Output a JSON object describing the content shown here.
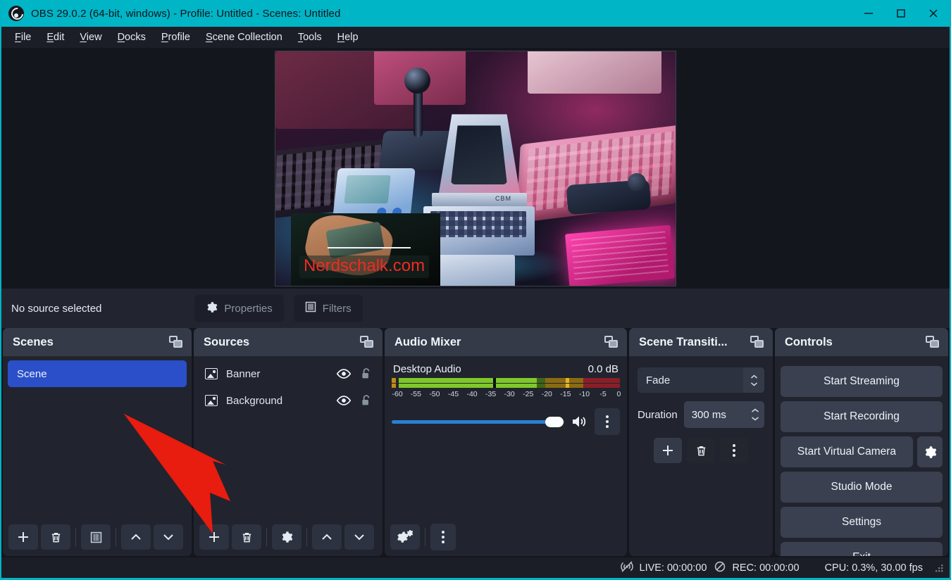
{
  "window": {
    "title": "OBS 29.0.2 (64-bit, windows) - Profile: Untitled - Scenes: Untitled",
    "logo": "obs-logo-icon",
    "accent_color": "#00b5c6",
    "controls": {
      "minimize": "minimize-icon",
      "maximize": "maximize-icon",
      "close": "close-icon"
    }
  },
  "menubar": {
    "items": [
      {
        "label": "File",
        "mnemonic": "F"
      },
      {
        "label": "Edit",
        "mnemonic": "E"
      },
      {
        "label": "View",
        "mnemonic": "V"
      },
      {
        "label": "Docks",
        "mnemonic": "D"
      },
      {
        "label": "Profile",
        "mnemonic": "P"
      },
      {
        "label": "Scene Collection",
        "mnemonic": "S"
      },
      {
        "label": "Tools",
        "mnemonic": "T"
      },
      {
        "label": "Help",
        "mnemonic": "H"
      }
    ]
  },
  "preview": {
    "banner_text": "Nerdschalk.com",
    "banner_text_color": "#f02b22",
    "description": "retro computer desk with neon pink and blue lighting"
  },
  "source_bar": {
    "status": "No source selected",
    "properties_label": "Properties",
    "filters_label": "Filters"
  },
  "scenes": {
    "title": "Scenes",
    "items": [
      {
        "label": "Scene",
        "selected": true
      }
    ],
    "selection_color": "#2a4fc8",
    "toolbar": [
      {
        "name": "add-scene-button",
        "icon": "plus-icon"
      },
      {
        "name": "remove-scene-button",
        "icon": "trash-icon"
      },
      {
        "name": "scene-filters-button",
        "icon": "filter-icon"
      },
      {
        "name": "move-scene-up-button",
        "icon": "chevron-up-icon"
      },
      {
        "name": "move-scene-down-button",
        "icon": "chevron-down-icon"
      }
    ]
  },
  "sources": {
    "title": "Sources",
    "items": [
      {
        "label": "Banner",
        "icon": "image-icon",
        "visible": true,
        "locked": false
      },
      {
        "label": "Background",
        "icon": "image-icon",
        "visible": true,
        "locked": false
      }
    ],
    "toolbar": [
      {
        "name": "add-source-button",
        "icon": "plus-icon"
      },
      {
        "name": "remove-source-button",
        "icon": "trash-icon"
      },
      {
        "name": "source-properties-button",
        "icon": "gear-icon"
      },
      {
        "name": "move-source-up-button",
        "icon": "chevron-up-icon"
      },
      {
        "name": "move-source-down-button",
        "icon": "chevron-down-icon"
      }
    ]
  },
  "mixer": {
    "title": "Audio Mixer",
    "channel": {
      "name": "Desktop Audio",
      "level": "0.0 dB",
      "volume_percent": 90,
      "muted": false,
      "meter_ticks": [
        "-60",
        "-55",
        "-50",
        "-45",
        "-40",
        "-35",
        "-30",
        "-25",
        "-20",
        "-15",
        "-10",
        "-5",
        "0"
      ],
      "meter_peak_db": -22
    },
    "toolbar": [
      {
        "name": "advanced-audio-properties-button",
        "icon": "dual-gear-icon"
      },
      {
        "name": "mixer-menu-button",
        "icon": "vertical-dots-icon"
      }
    ]
  },
  "transitions": {
    "title": "Scene Transiti...",
    "transition": "Fade",
    "duration_label": "Duration",
    "duration_value": "300 ms",
    "buttons": [
      {
        "name": "add-transition-button",
        "icon": "plus-icon"
      },
      {
        "name": "remove-transition-button",
        "icon": "trash-icon"
      },
      {
        "name": "transition-menu-button",
        "icon": "vertical-dots-icon"
      }
    ]
  },
  "controls": {
    "title": "Controls",
    "buttons": [
      {
        "label": "Start Streaming",
        "name": "start-streaming-button"
      },
      {
        "label": "Start Recording",
        "name": "start-recording-button"
      },
      {
        "label": "Start Virtual Camera",
        "name": "start-virtual-camera-button",
        "has_gear": true
      },
      {
        "label": "Studio Mode",
        "name": "studio-mode-button"
      },
      {
        "label": "Settings",
        "name": "settings-button"
      },
      {
        "label": "Exit",
        "name": "exit-button"
      }
    ]
  },
  "statusbar": {
    "live": "LIVE: 00:00:00",
    "rec": "REC: 00:00:00",
    "cpu": "CPU: 0.3%, 30.00 fps"
  },
  "annotation": {
    "arrow_color": "#e81c0f",
    "points_to": "add-source-button"
  }
}
